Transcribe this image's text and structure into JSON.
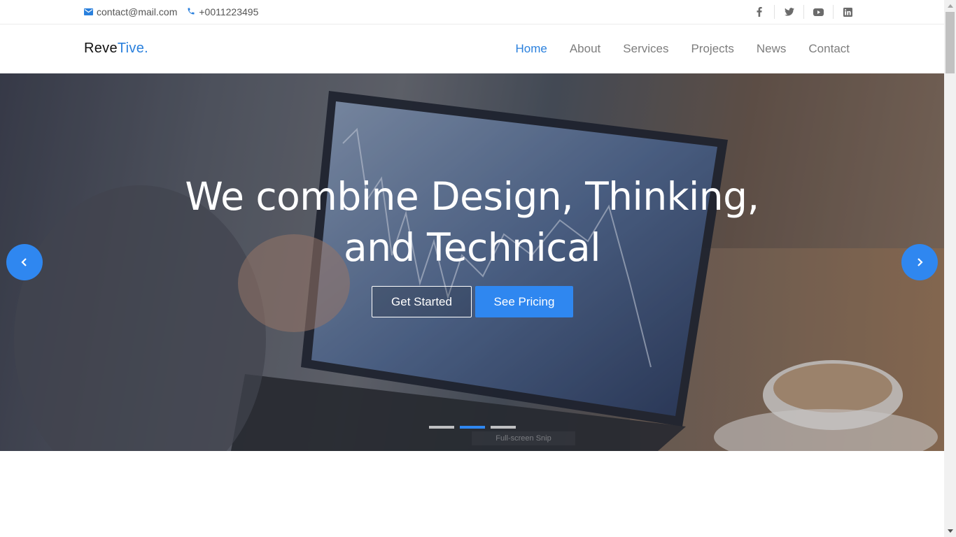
{
  "topbar": {
    "email": "contact@mail.com",
    "phone": "+0011223495",
    "socials": [
      "facebook-icon",
      "twitter-icon",
      "youtube-icon",
      "linkedin-icon"
    ]
  },
  "header": {
    "logo_main": "Reve",
    "logo_accent": "Tive.",
    "nav": [
      {
        "label": "Home",
        "active": true
      },
      {
        "label": "About",
        "active": false
      },
      {
        "label": "Services",
        "active": false
      },
      {
        "label": "Projects",
        "active": false
      },
      {
        "label": "News",
        "active": false
      },
      {
        "label": "Contact",
        "active": false
      }
    ]
  },
  "hero": {
    "headline_line1": "We combine Design, Thinking,",
    "headline_line2": "and Technical",
    "primary_outline_button": "Get Started",
    "primary_button": "See Pricing",
    "active_slide": 2,
    "slide_count": 3,
    "snip_overlay": "Full-screen Snip"
  },
  "colors": {
    "accent": "#2a80dd",
    "button_blue": "#2f87f0",
    "nav_text": "#7d7d7d"
  }
}
